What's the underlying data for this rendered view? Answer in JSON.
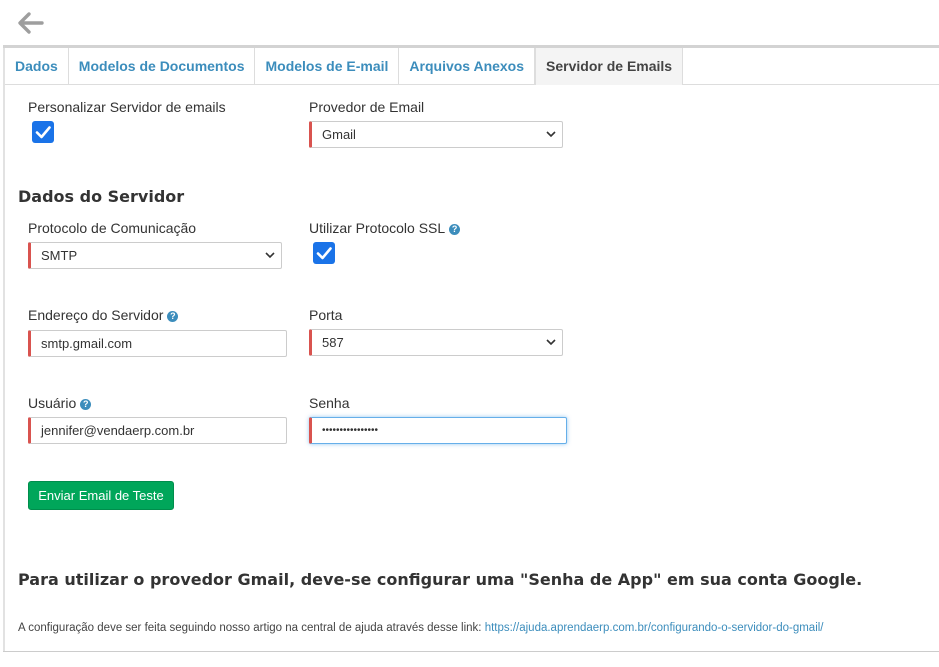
{
  "header": {
    "back_icon": "arrow-left-icon"
  },
  "tabs": [
    {
      "label": "Dados",
      "active": false
    },
    {
      "label": "Modelos de Documentos",
      "active": false
    },
    {
      "label": "Modelos de E-mail",
      "active": false
    },
    {
      "label": "Arquivos Anexos",
      "active": false
    },
    {
      "label": "Servidor de Emails",
      "active": true
    }
  ],
  "form": {
    "custom_server": {
      "label": "Personalizar Servidor de emails",
      "checked": true
    },
    "provider": {
      "label": "Provedor de Email",
      "value": "Gmail"
    },
    "section_title": "Dados do Servidor",
    "protocol": {
      "label": "Protocolo de Comunicação",
      "value": "SMTP"
    },
    "ssl": {
      "label": "Utilizar Protocolo SSL",
      "checked": true
    },
    "server_address": {
      "label": "Endereço do Servidor",
      "value": "smtp.gmail.com"
    },
    "port": {
      "label": "Porta",
      "value": "587"
    },
    "user": {
      "label": "Usuário",
      "value": "jennifer@vendaerp.com.br"
    },
    "password": {
      "label": "Senha",
      "value": "••••••••••••••••"
    },
    "test_button": "Enviar Email de Teste"
  },
  "notice": {
    "title": "Para utilizar o provedor Gmail, deve-se configurar uma \"Senha de App\" em sua conta Google.",
    "text": "A configuração deve ser feita seguindo nosso artigo na central de ajuda através desse link:",
    "link": "https://ajuda.aprendaerp.com.br/configurando-o-servidor-do-gmail/"
  },
  "colors": {
    "accent": "#3c8dbc",
    "checkbox": "#1a73e8",
    "required": "#d9534f",
    "success": "#00a65a"
  }
}
